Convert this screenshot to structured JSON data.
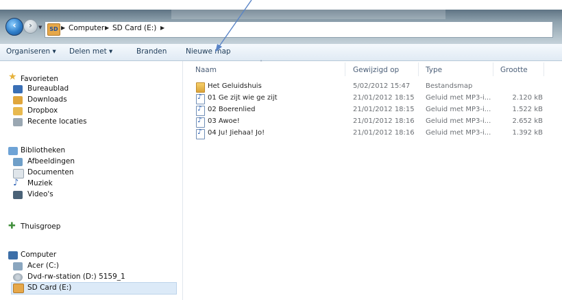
{
  "breadcrumb": {
    "items": [
      "Computer",
      "SD Card (E:)"
    ],
    "icon": "sd-card-icon"
  },
  "toolbar": {
    "organize": "Organiseren ▾",
    "share": "Delen met ▾",
    "burn": "Branden",
    "new_folder": "Nieuwe map"
  },
  "sidebar": {
    "favorites": {
      "header": "Favorieten",
      "items": [
        "Bureaublad",
        "Downloads",
        "Dropbox",
        "Recente locaties"
      ]
    },
    "libraries": {
      "header": "Bibliotheken",
      "items": [
        "Afbeeldingen",
        "Documenten",
        "Muziek",
        "Video's"
      ]
    },
    "homegroup": "Thuisgroep",
    "computer": {
      "header": "Computer",
      "items": [
        "Acer (C:)",
        "Dvd-rw-station (D:) 5159_1",
        "SD Card (E:)"
      ],
      "selected": "SD Card (E:)"
    }
  },
  "columns": {
    "name": "Naam",
    "modified": "Gewijzigd op",
    "type": "Type",
    "size": "Grootte"
  },
  "files": [
    {
      "name": "Het Geluidshuis",
      "modified": "5/02/2012 15:47",
      "type": "Bestandsmap",
      "size": "",
      "kind": "folder"
    },
    {
      "name": "01 Ge zijt wie ge zijt",
      "modified": "21/01/2012 18:15",
      "type": "Geluid met MP3-i...",
      "size": "2.120 kB",
      "kind": "audio"
    },
    {
      "name": "02 Boerenlied",
      "modified": "21/01/2012 18:15",
      "type": "Geluid met MP3-i...",
      "size": "1.522 kB",
      "kind": "audio"
    },
    {
      "name": "03 Awoe!",
      "modified": "21/01/2012 18:16",
      "type": "Geluid met MP3-i...",
      "size": "2.652 kB",
      "kind": "audio"
    },
    {
      "name": "04 Ju! Jiehaa! Jo!",
      "modified": "21/01/2012 18:16",
      "type": "Geluid met MP3-i...",
      "size": "1.392 kB",
      "kind": "audio"
    }
  ],
  "colors": {
    "accent": "#1c3a57",
    "selection": "#dceaf8",
    "arrow": "#5a84c6"
  }
}
